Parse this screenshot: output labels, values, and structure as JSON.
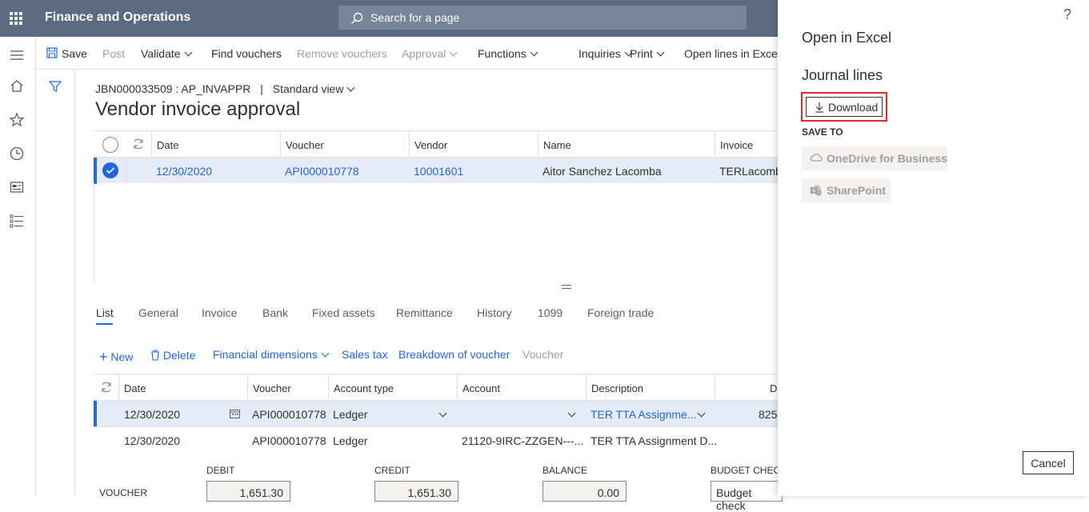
{
  "topbar": {
    "app_title": "Finance and Operations",
    "search_placeholder": "Search for a page"
  },
  "actions": {
    "save": "Save",
    "post": "Post",
    "validate": "Validate",
    "find_vouchers": "Find vouchers",
    "remove_vouchers": "Remove vouchers",
    "approval": "Approval",
    "functions": "Functions",
    "inquiries": "Inquiries",
    "print": "Print",
    "open_lines_excel": "Open lines in Excel"
  },
  "page": {
    "journal_id": "JBN000033509 : AP_INVAPPR",
    "separator": "|",
    "view": "Standard view",
    "title": "Vendor invoice approval"
  },
  "header_grid": {
    "columns": [
      "Date",
      "Voucher",
      "Vendor",
      "Name",
      "Invoice"
    ],
    "rows": [
      {
        "date": "12/30/2020",
        "voucher": "API000010778",
        "vendor": "10001601",
        "name": "Aitor Sanchez Lacomba",
        "invoice": "TERLacomba"
      }
    ]
  },
  "tabs": [
    "List",
    "General",
    "Invoice",
    "Bank",
    "Fixed assets",
    "Remittance",
    "History",
    "1099",
    "Foreign trade"
  ],
  "lines_toolbar": {
    "new": "New",
    "delete": "Delete",
    "financial_dimensions": "Financial dimensions",
    "sales_tax": "Sales tax",
    "breakdown": "Breakdown of voucher",
    "voucher": "Voucher"
  },
  "lines_grid": {
    "columns": [
      "Date",
      "Voucher",
      "Account type",
      "Account",
      "Description",
      "De"
    ],
    "rows": [
      {
        "date": "12/30/2020",
        "voucher": "API000010778",
        "account_type": "Ledger",
        "account": "",
        "description": "TER TTA Assignme...",
        "debit": "825"
      },
      {
        "date": "12/30/2020",
        "voucher": "API000010778",
        "account_type": "Ledger",
        "account": "21120-9IRC-ZZGEN---...",
        "description": "TER TTA Assignment D...",
        "debit": ""
      }
    ]
  },
  "totals": {
    "debit_label": "DEBIT",
    "credit_label": "CREDIT",
    "balance_label": "BALANCE",
    "budget_label": "BUDGET CHECK",
    "voucher_label": "VOUCHER",
    "debit": "1,651.30",
    "credit": "1,651.30",
    "balance": "0.00",
    "budget": "Budget check"
  },
  "panel": {
    "help": "?",
    "title": "Open in Excel",
    "subtitle": "Journal lines",
    "download": "Download",
    "save_to": "SAVE TO",
    "onedrive": "OneDrive for Business",
    "sharepoint": "SharePoint",
    "cancel": "Cancel"
  },
  "colors": {
    "topbar": "#5b6c82",
    "accent": "#2266e3",
    "highlight": "#e1262d",
    "selected_row": "#e5ecf7"
  }
}
